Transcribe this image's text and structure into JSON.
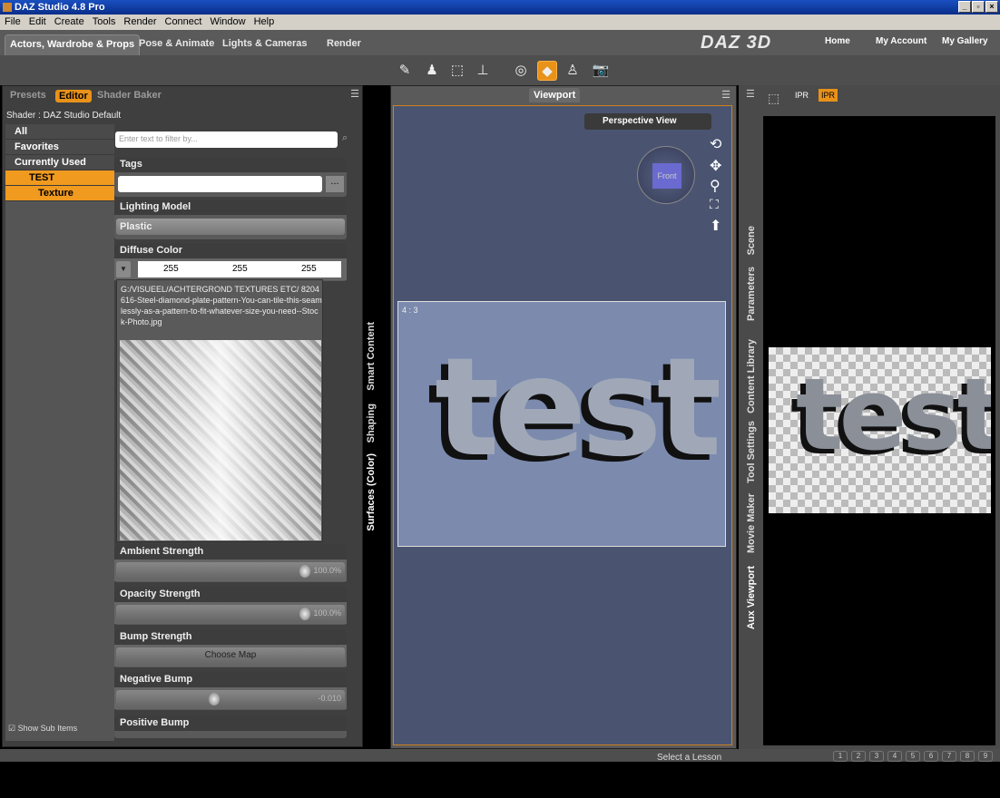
{
  "window": {
    "title": "DAZ Studio 4.8 Pro"
  },
  "menu": [
    "File",
    "Edit",
    "Create",
    "Tools",
    "Render",
    "Connect",
    "Window",
    "Help"
  ],
  "tabs": [
    "Actors, Wardrobe & Props",
    "Pose & Animate",
    "Lights & Cameras",
    "Render"
  ],
  "brand": "DAZ 3D",
  "toplinks": [
    "Home",
    "My Account",
    "My Gallery"
  ],
  "left": {
    "tabs": [
      "Presets",
      "Editor",
      "Shader Baker"
    ],
    "shader": "Shader : DAZ Studio Default",
    "categories": [
      "All",
      "Favorites",
      "Currently Used",
      "TEST",
      "Texture"
    ],
    "filter_placeholder": "Enter text to filter by...",
    "props": {
      "tags": "Tags",
      "lighting": "Lighting Model",
      "lighting_value": "Plastic",
      "diffuse": "Diffuse Color",
      "diffuse_r": "255",
      "diffuse_g": "255",
      "diffuse_b": "255",
      "ambient": "Ambient Strength",
      "ambient_val": "100.0%",
      "opacity": "Opacity Strength",
      "opacity_val": "100.0%",
      "bump": "Bump Strength",
      "bump_map": "Choose Map",
      "negbump": "Negative Bump",
      "negbump_val": "-0.010",
      "posbump": "Positive Bump"
    },
    "texpath": "G:/VISUEEL/ACHTERGROND TEXTURES ETC/ 8204616-Steel-diamond-plate-pattern-You-can-tile-this-seamlessly-as-a-pattern-to-fit-whatever-size-you-need--Stock-Photo.jpg",
    "show_sub": "Show Sub Items",
    "side_tabs": [
      "Smart Content",
      "Shaping",
      "Surfaces (Color)"
    ]
  },
  "viewport": {
    "tab": "Viewport",
    "camera": "Perspective View",
    "ratio": "4 : 3",
    "cube": "Front",
    "text": "test"
  },
  "aux": {
    "side_tabs": [
      "Scene",
      "Parameters",
      "Content Library",
      "Tool Settings",
      "Movie Maker",
      "Aux Viewport"
    ],
    "ipr1": "IPR",
    "ipr2": "IPR",
    "text": "test"
  },
  "bottom": {
    "lesson": "Select a Lesson",
    "pages": [
      "1",
      "2",
      "3",
      "4",
      "5",
      "6",
      "7",
      "8",
      "9"
    ]
  },
  "colors": {
    "accent": "#e8921a",
    "viewport": "#4a5470",
    "frame": "#7b8aad"
  }
}
